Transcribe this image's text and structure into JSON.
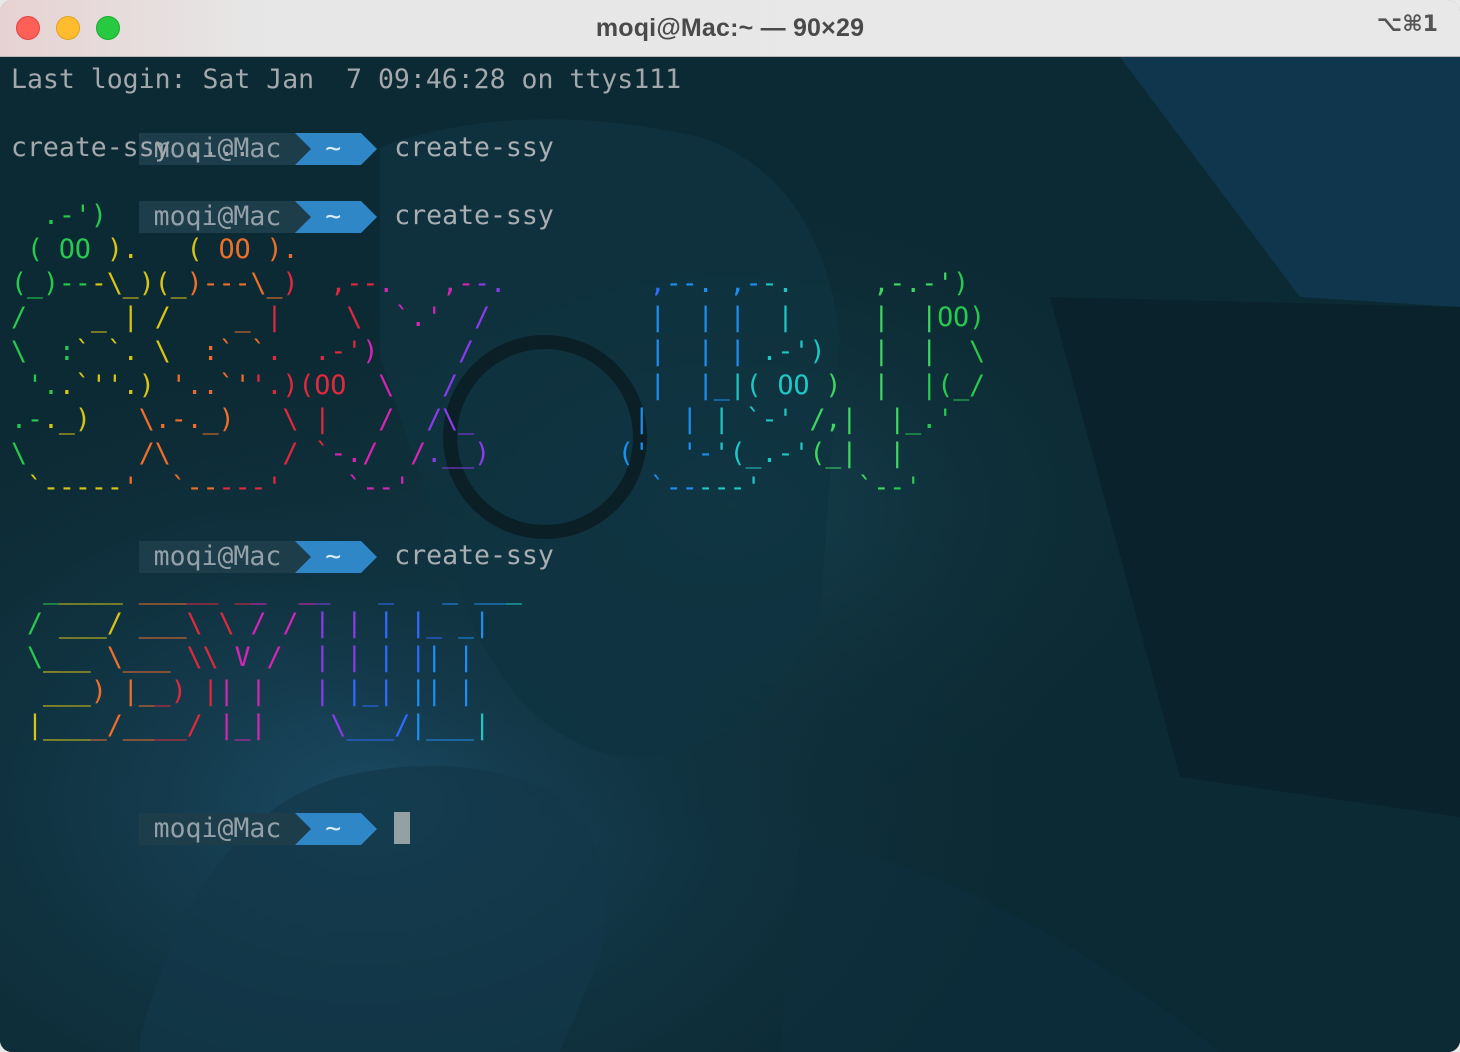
{
  "window": {
    "title": "moqi@Mac:~ — 90×29",
    "shortcut": "⌥⌘1"
  },
  "terminal": {
    "login_line": "Last login: Sat Jan  7 09:46:28 on ttys111",
    "prompt_user": "moqi@Mac",
    "prompt_dir": "~",
    "command1": "create-ssy",
    "output1": "create-ssy ....",
    "command2": "create-ssy",
    "command3": "create-ssy",
    "art1": [
      "  .-')      .-')",
      " ( OO ).   ( OO ).",
      "(_)---\\_)(_)---\\_)  ,--.   ,--.         ,--. ,--.     ,-.-')",
      "/    _ | /    _ |    \\  `.'  /          |  | |  |     |  |OO)",
      "\\  :` `. \\  :` `.  .-')     /           |  | | .-')   |  |  \\",
      " '..`''.) '..`''.)(OO  \\   /            |  |_|( OO )  |  |(_/",
      ".-._)   \\.-._)   \\ |   /  /\\_          |  | | `-' /,|  |_.'",
      "\\       /\\       / `-./  /.__)        ('  '-'(_.-'(_|  |",
      " `-----'  `-----'    `--'               `-----'      `--'"
    ],
    "art2": [
      "  _____ _____ __  __   _   _ ___",
      " / ___/ ___\\ \\ / / | | | |_ _|",
      " \\___ \\___ \\\\ V /  | | | || |",
      "  ___) |__) || |   | |_| || |",
      " |____/____/ |_|    \\___/|___|"
    ],
    "palette": [
      "#28c94f",
      "#d7c515",
      "#ef6f2a",
      "#e0293f",
      "#d426b4",
      "#8a3bea",
      "#2f6bff",
      "#1e8ff0",
      "#1ec7c3",
      "#3fd660"
    ]
  }
}
